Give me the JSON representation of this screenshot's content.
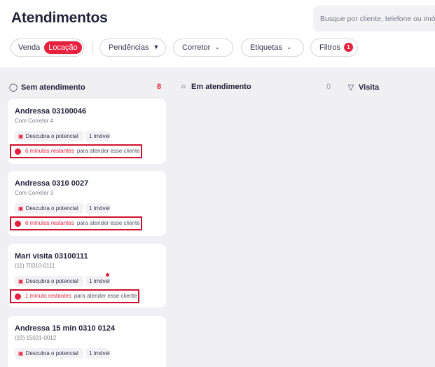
{
  "header": {
    "title": "Atendimentos",
    "search_placeholder": "Busque por cliente, telefone ou imóv"
  },
  "filters": {
    "toggle": {
      "venda": "Venda",
      "locacao": "Locação",
      "selected": "Locação"
    },
    "pendencias": "Pendências",
    "corretor": "Corretor",
    "etiquetas": "Etiquetas",
    "filtros": "Filtros",
    "filtros_count": "1"
  },
  "columns": [
    {
      "title": "Sem atendimento",
      "count": "8",
      "icon": "user-clock-icon"
    },
    {
      "title": "Em atendimento",
      "count": "0",
      "icon": "users-chat-icon"
    },
    {
      "title": "Visita",
      "count": "",
      "icon": "mug-icon"
    }
  ],
  "cards": [
    {
      "name": "Andressa 03100046",
      "sub": "Com Corretor 4",
      "tag": "Descubra o potencial",
      "imoveis": "1 imóvel",
      "timer": "6 minutos restantes",
      "timer_suffix": "para atender esse cliente"
    },
    {
      "name": "Andressa 0310 0027",
      "sub": "Com Corretor 3",
      "tag": "Descubra o potencial",
      "imoveis": "1 imóvel",
      "timer": "6 minutos restantes",
      "timer_suffix": "para atender esse cliente"
    },
    {
      "name": "Mari visita 03100111",
      "sub": "(11) 70310-0111",
      "tag": "Descubra o potencial",
      "imoveis": "1 imóvel",
      "timer": "1 minuto restantes",
      "timer_suffix": "para atender esse cliente"
    },
    {
      "name": "Andressa 15 min 0310 0124",
      "sub": "(19) 15031-0012",
      "tag": "Descubra o potencial",
      "imoveis": "1 imóvel",
      "timer": "",
      "timer_suffix": ""
    }
  ],
  "colors": {
    "accent": "#e8203f",
    "board_bg": "#f0f0f3",
    "highlight_box": "#d0102c"
  }
}
